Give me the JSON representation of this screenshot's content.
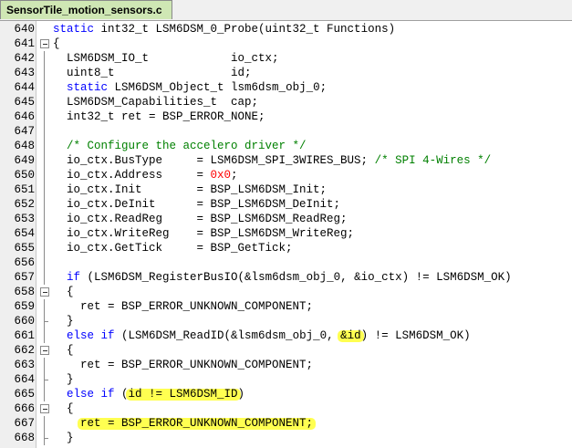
{
  "tab": {
    "label": "SensorTile_motion_sensors.c"
  },
  "lines": [
    {
      "n": "640",
      "fold": "",
      "tokens": [
        {
          "t": "static",
          "c": "kw"
        },
        {
          "t": " int32_t LSM6DSM_0_Probe(uint32_t Functions)",
          "c": "plain"
        }
      ]
    },
    {
      "n": "641",
      "fold": "box",
      "tokens": [
        {
          "t": "{",
          "c": "plain"
        }
      ]
    },
    {
      "n": "642",
      "fold": "line",
      "tokens": [
        {
          "t": "  LSM6DSM_IO_t            io_ctx;",
          "c": "plain"
        }
      ]
    },
    {
      "n": "643",
      "fold": "line",
      "tokens": [
        {
          "t": "  uint8_t                 id;",
          "c": "plain"
        }
      ]
    },
    {
      "n": "644",
      "fold": "line",
      "tokens": [
        {
          "t": "  ",
          "c": "plain"
        },
        {
          "t": "static",
          "c": "kw"
        },
        {
          "t": " LSM6DSM_Object_t lsm6dsm_obj_0;",
          "c": "plain"
        }
      ]
    },
    {
      "n": "645",
      "fold": "line",
      "tokens": [
        {
          "t": "  LSM6DSM_Capabilities_t  cap;",
          "c": "plain"
        }
      ]
    },
    {
      "n": "646",
      "fold": "line",
      "tokens": [
        {
          "t": "  int32_t ret = BSP_ERROR_NONE;",
          "c": "plain"
        }
      ]
    },
    {
      "n": "647",
      "fold": "line",
      "tokens": []
    },
    {
      "n": "648",
      "fold": "line",
      "tokens": [
        {
          "t": "  /* Configure the accelero driver */",
          "c": "cm"
        }
      ]
    },
    {
      "n": "649",
      "fold": "line",
      "tokens": [
        {
          "t": "  io_ctx.BusType     = LSM6DSM_SPI_3WIRES_BUS; ",
          "c": "plain"
        },
        {
          "t": "/* SPI 4-Wires */",
          "c": "cm"
        }
      ]
    },
    {
      "n": "650",
      "fold": "line",
      "tokens": [
        {
          "t": "  io_ctx.Address     = ",
          "c": "plain"
        },
        {
          "t": "0x0",
          "c": "num"
        },
        {
          "t": ";",
          "c": "plain"
        }
      ]
    },
    {
      "n": "651",
      "fold": "line",
      "tokens": [
        {
          "t": "  io_ctx.Init        = BSP_LSM6DSM_Init;",
          "c": "plain"
        }
      ]
    },
    {
      "n": "652",
      "fold": "line",
      "tokens": [
        {
          "t": "  io_ctx.DeInit      = BSP_LSM6DSM_DeInit;",
          "c": "plain"
        }
      ]
    },
    {
      "n": "653",
      "fold": "line",
      "tokens": [
        {
          "t": "  io_ctx.ReadReg     = BSP_LSM6DSM_ReadReg;",
          "c": "plain"
        }
      ]
    },
    {
      "n": "654",
      "fold": "line",
      "tokens": [
        {
          "t": "  io_ctx.WriteReg    = BSP_LSM6DSM_WriteReg;",
          "c": "plain"
        }
      ]
    },
    {
      "n": "655",
      "fold": "line",
      "tokens": [
        {
          "t": "  io_ctx.GetTick     = BSP_GetTick;",
          "c": "plain"
        }
      ]
    },
    {
      "n": "656",
      "fold": "line",
      "tokens": []
    },
    {
      "n": "657",
      "fold": "line",
      "tokens": [
        {
          "t": "  ",
          "c": "plain"
        },
        {
          "t": "if",
          "c": "kw"
        },
        {
          "t": " (LSM6DSM_RegisterBusIO(&lsm6dsm_obj_0, &io_ctx) != LSM6DSM_OK)",
          "c": "plain"
        }
      ]
    },
    {
      "n": "658",
      "fold": "box",
      "tokens": [
        {
          "t": "  {",
          "c": "plain"
        }
      ]
    },
    {
      "n": "659",
      "fold": "line",
      "tokens": [
        {
          "t": "    ret = BSP_ERROR_UNKNOWN_COMPONENT;",
          "c": "plain"
        }
      ]
    },
    {
      "n": "660",
      "fold": "end",
      "tokens": [
        {
          "t": "  }",
          "c": "plain"
        }
      ]
    },
    {
      "n": "661",
      "fold": "line",
      "tokens": [
        {
          "t": "  ",
          "c": "plain"
        },
        {
          "t": "else if",
          "c": "kw"
        },
        {
          "t": " (LSM6DSM_ReadID(&lsm6dsm_obj_0, &id) != LSM6DSM_OK)",
          "c": "plain"
        }
      ]
    },
    {
      "n": "662",
      "fold": "box",
      "tokens": [
        {
          "t": "  {",
          "c": "plain"
        }
      ]
    },
    {
      "n": "663",
      "fold": "line",
      "tokens": [
        {
          "t": "    ret = BSP_ERROR_UNKNOWN_COMPONENT;",
          "c": "plain"
        }
      ]
    },
    {
      "n": "664",
      "fold": "end",
      "tokens": [
        {
          "t": "  }",
          "c": "plain"
        }
      ]
    },
    {
      "n": "665",
      "fold": "line",
      "tokens": [
        {
          "t": "  ",
          "c": "plain"
        },
        {
          "t": "else if",
          "c": "kw"
        },
        {
          "t": " (id != LSM6DSM_ID)",
          "c": "plain"
        }
      ]
    },
    {
      "n": "666",
      "fold": "box",
      "tokens": [
        {
          "t": "  {",
          "c": "plain"
        }
      ]
    },
    {
      "n": "667",
      "fold": "line",
      "tokens": [
        {
          "t": "    ret = BSP_ERROR_UNKNOWN_COMPONENT;",
          "c": "plain"
        }
      ]
    },
    {
      "n": "668",
      "fold": "end",
      "tokens": [
        {
          "t": "  }",
          "c": "plain"
        }
      ]
    }
  ],
  "highlights": [
    {
      "line": "661",
      "text": "&id"
    },
    {
      "line": "665",
      "text": "id != LSM6DSM_ID"
    },
    {
      "line": "667",
      "text": "ret = BSP_ERROR_UNKNOWN_COMPONENT;"
    }
  ],
  "colors": {
    "keyword": "#0000ff",
    "comment": "#008000",
    "number": "#ff0000",
    "highlight": "#ffff33",
    "tab": "#cfe7b4"
  }
}
